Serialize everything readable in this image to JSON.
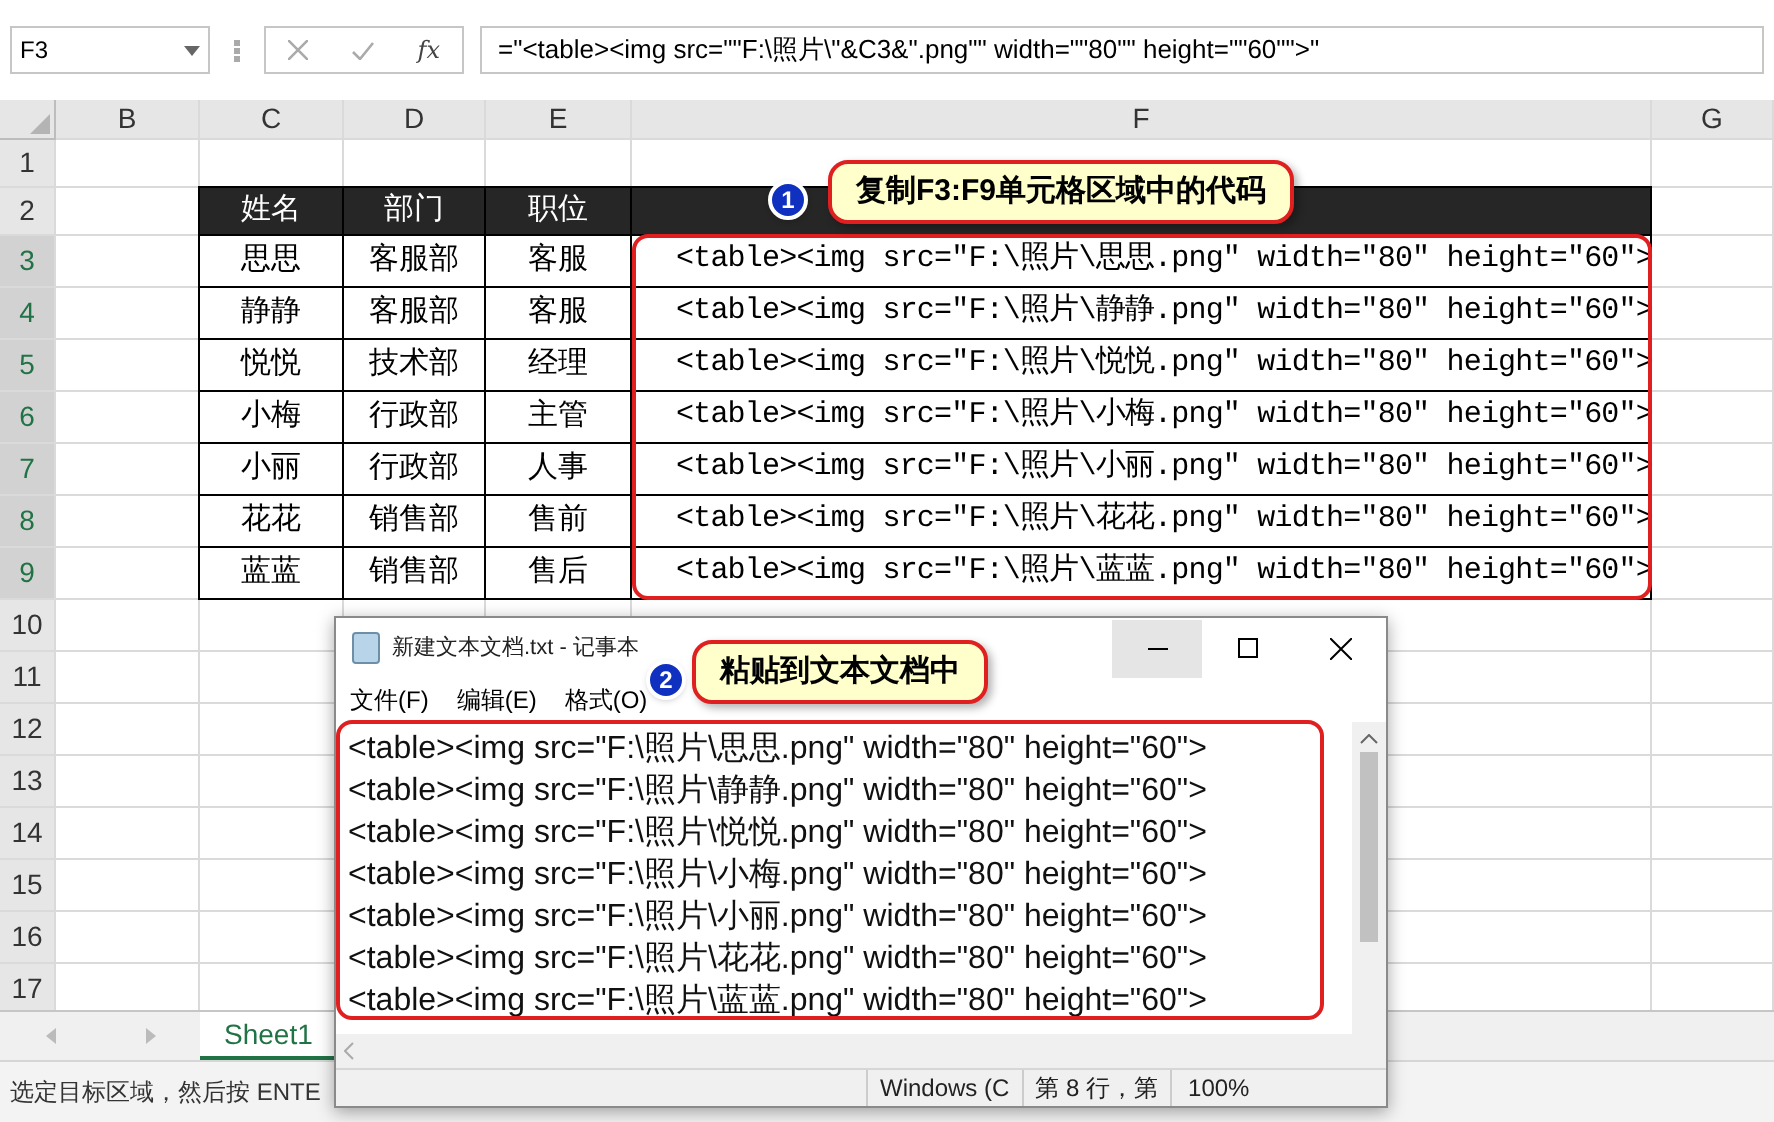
{
  "formula_bar": {
    "name_box": "F3",
    "function_button": "fx",
    "formula": "=\"<table><img src=\"\"F:\\照片\\\"&C3&\".png\"\" width=\"\"80\"\" height=\"\"60\"\">\""
  },
  "column_headers": [
    "B",
    "C",
    "D",
    "E",
    "F",
    "G"
  ],
  "row_headers": [
    "1",
    "2",
    "3",
    "4",
    "5",
    "6",
    "7",
    "8",
    "9",
    "10",
    "11",
    "12",
    "13",
    "14",
    "15",
    "16",
    "17"
  ],
  "table": {
    "columns": [
      "姓名",
      "部门",
      "职位"
    ],
    "rows": [
      {
        "name": "思思",
        "department": "客服部",
        "position": "客服",
        "code": "<table><img src=\"F:\\照片\\思思.png\" width=\"80\" height=\"60\">"
      },
      {
        "name": "静静",
        "department": "客服部",
        "position": "客服",
        "code": "<table><img src=\"F:\\照片\\静静.png\" width=\"80\" height=\"60\">"
      },
      {
        "name": "悦悦",
        "department": "技术部",
        "position": "经理",
        "code": "<table><img src=\"F:\\照片\\悦悦.png\" width=\"80\" height=\"60\">"
      },
      {
        "name": "小梅",
        "department": "行政部",
        "position": "主管",
        "code": "<table><img src=\"F:\\照片\\小梅.png\" width=\"80\" height=\"60\">"
      },
      {
        "name": "小丽",
        "department": "行政部",
        "position": "人事",
        "code": "<table><img src=\"F:\\照片\\小丽.png\" width=\"80\" height=\"60\">"
      },
      {
        "name": "花花",
        "department": "销售部",
        "position": "售前",
        "code": "<table><img src=\"F:\\照片\\花花.png\" width=\"80\" height=\"60\">"
      },
      {
        "name": "蓝蓝",
        "department": "销售部",
        "position": "售后",
        "code": "<table><img src=\"F:\\照片\\蓝蓝.png\" width=\"80\" height=\"60\">"
      }
    ]
  },
  "callouts": [
    {
      "number": "1",
      "text": "复制F3:F9单元格区域中的代码"
    },
    {
      "number": "2",
      "text": "粘贴到文本文档中"
    }
  ],
  "sheet_tabs": [
    {
      "label": "Sheet1",
      "selected": true
    }
  ],
  "status_bar": {
    "text": "选定目标区域，然后按 ENTE"
  },
  "notepad": {
    "title": "新建文本文档.txt - 记事本",
    "menu": [
      "文件(F)",
      "编辑(E)",
      "格式(O)"
    ],
    "lines": [
      "<table><img src=\"F:\\照片\\思思.png\" width=\"80\" height=\"60\">",
      "<table><img src=\"F:\\照片\\静静.png\" width=\"80\" height=\"60\">",
      "<table><img src=\"F:\\照片\\悦悦.png\" width=\"80\" height=\"60\">",
      "<table><img src=\"F:\\照片\\小梅.png\" width=\"80\" height=\"60\">",
      "<table><img src=\"F:\\照片\\小丽.png\" width=\"80\" height=\"60\">",
      "<table><img src=\"F:\\照片\\花花.png\" width=\"80\" height=\"60\">",
      "<table><img src=\"F:\\照片\\蓝蓝.png\" width=\"80\" height=\"60\">"
    ],
    "status": [
      "Windows (C",
      "第 8 行，第",
      "100%"
    ]
  }
}
